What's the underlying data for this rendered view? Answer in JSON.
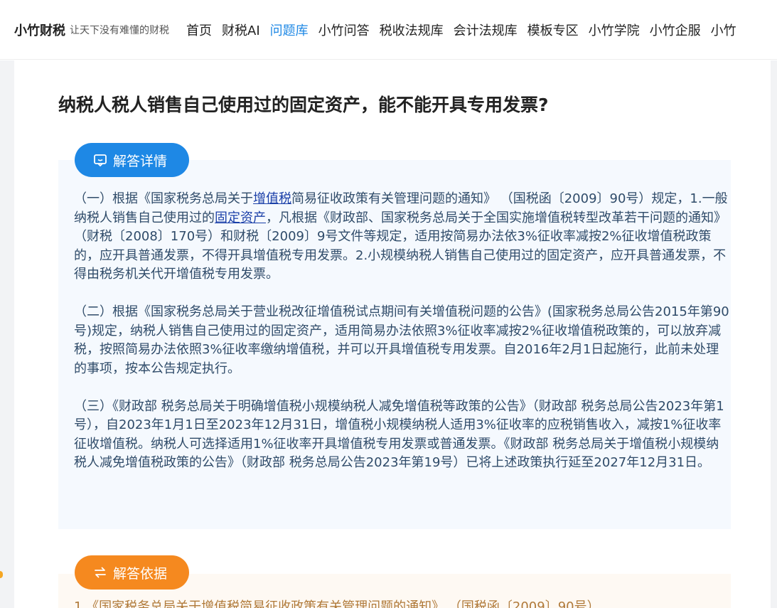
{
  "header": {
    "logo": "小竹财税",
    "slogan": "让天下没有难懂的财税",
    "nav": [
      {
        "label": "首页",
        "active": false
      },
      {
        "label": "财税AI",
        "active": false
      },
      {
        "label": "问题库",
        "active": true
      },
      {
        "label": "小竹问答",
        "active": false
      },
      {
        "label": "税收法规库",
        "active": false
      },
      {
        "label": "会计法规库",
        "active": false
      },
      {
        "label": "模板专区",
        "active": false
      },
      {
        "label": "小竹学院",
        "active": false
      },
      {
        "label": "小竹企服",
        "active": false
      },
      {
        "label": "小竹",
        "active": false
      }
    ]
  },
  "question": {
    "title": "纳税人税人销售自己使用过的固定资产，能不能开具专用发票?"
  },
  "answer": {
    "label": "解答详情",
    "p1": {
      "a": "（一）根据《国家税务总局关于",
      "link1": "增值税",
      "b": "简易征收政策有关管理问题的通知》 （国税函〔2009〕90号）规定，1.一般纳税人销售自己使用过的",
      "link2": "固定资产",
      "c": "，凡根据《财政部、国家税务总局关于全国实施增值税转型改革若干问题的通知》（财税〔2008〕170号）和财税〔2009〕9号文件等规定，适用按简易办法依3%征收率减按2%征收增值税政策的，应开具普通发票，不得开具增值税专用发票。2.小规模纳税人销售自己使用过的固定资产，应开具普通发票，不得由税务机关代开增值税专用发票。"
    },
    "p2": "（二）根据《国家税务总局关于营业税改征增值税试点期间有关增值税问题的公告》(国家税务总局公告2015年第90号)规定，纳税人销售自己使用过的固定资产，适用简易办法依照3%征收率减按2%征收增值税政策的，可以放弃减税，按照简易办法依照3%征收率缴纳增值税，并可以开具增值税专用发票。自2016年2月1日起施行，此前未处理的事项，按本公告规定执行。",
    "p3": "（三）《财政部 税务总局关于明确增值税小规模纳税人减免增值税等政策的公告》（财政部 税务总局公告2023年第1号），自2023年1月1日至2023年12月31日，增值税小规模纳税人适用3%征收率的应税销售收入，减按1%征收率征收增值税。纳税人可选择适用1%征收率开具增值税专用发票或普通发票。《财政部 税务总局关于增值税小规模纳税人减免增值税政策的公告》（财政部 税务总局公告2023年第19号）已将上述政策执行延至2027年12月31日。"
  },
  "basis": {
    "label": "解答依据",
    "first_item": "1.《国家税务总局关于增值税简易征收政策有关管理问题的通知》 （国税函〔2009〕90号）"
  },
  "colors": {
    "accent_blue": "#1e88e5",
    "accent_orange": "#f5891f"
  }
}
